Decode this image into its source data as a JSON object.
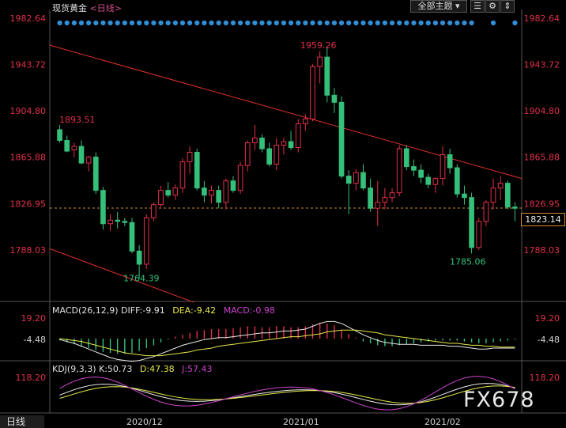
{
  "header": {
    "symbol": "现货黄金",
    "period": "<日线>",
    "theme_button": "全部主题",
    "tool_icons": [
      "list-icon",
      "settings-icon",
      "scroll-icon"
    ]
  },
  "colors": {
    "up": "#e0304a",
    "down": "#35c07a",
    "axis_text": "#e0304a",
    "trend": "#e0302a",
    "dots": "#2f8fd8",
    "cursor_line": "#d08a2a",
    "diff": "#e8e8e8",
    "dea": "#e8e84a",
    "macd": "#cc44cc"
  },
  "chart_data": [
    {
      "type": "candlestick",
      "title": "现货黄金 <日线>",
      "price_axis_left": [
        "1982.64",
        "1943.72",
        "1904.80",
        "1865.88",
        "1826.95",
        "1788.03"
      ],
      "price_axis_right": [
        "1982.64",
        "1943.72",
        "1904.80",
        "1865.88",
        "1826.95",
        "1788.03"
      ],
      "ylim": [
        1760,
        1986
      ],
      "x_labels": [
        "2020/12",
        "2021/01",
        "2021/02"
      ],
      "annotations": [
        {
          "label": "1893.51",
          "value": 1893.51
        },
        {
          "label": "1959.26",
          "value": 1959.26
        },
        {
          "label": "1764.39",
          "value": 1764.39
        },
        {
          "label": "1785.06",
          "value": 1785.06
        }
      ],
      "current_price": "1823.14",
      "candles": [
        {
          "o": 1889,
          "h": 1893,
          "l": 1878,
          "c": 1880
        },
        {
          "o": 1880,
          "h": 1884,
          "l": 1870,
          "c": 1871
        },
        {
          "o": 1872,
          "h": 1878,
          "l": 1866,
          "c": 1875
        },
        {
          "o": 1875,
          "h": 1880,
          "l": 1860,
          "c": 1861
        },
        {
          "o": 1861,
          "h": 1867,
          "l": 1854,
          "c": 1866
        },
        {
          "o": 1866,
          "h": 1870,
          "l": 1835,
          "c": 1838
        },
        {
          "o": 1838,
          "h": 1841,
          "l": 1805,
          "c": 1810
        },
        {
          "o": 1810,
          "h": 1818,
          "l": 1804,
          "c": 1813
        },
        {
          "o": 1813,
          "h": 1820,
          "l": 1806,
          "c": 1812
        },
        {
          "o": 1812,
          "h": 1815,
          "l": 1808,
          "c": 1811
        },
        {
          "o": 1811,
          "h": 1815,
          "l": 1785,
          "c": 1787
        },
        {
          "o": 1787,
          "h": 1792,
          "l": 1764,
          "c": 1776
        },
        {
          "o": 1776,
          "h": 1818,
          "l": 1772,
          "c": 1815
        },
        {
          "o": 1815,
          "h": 1828,
          "l": 1812,
          "c": 1826
        },
        {
          "o": 1826,
          "h": 1842,
          "l": 1824,
          "c": 1838
        },
        {
          "o": 1838,
          "h": 1845,
          "l": 1832,
          "c": 1834
        },
        {
          "o": 1834,
          "h": 1843,
          "l": 1830,
          "c": 1840
        },
        {
          "o": 1840,
          "h": 1865,
          "l": 1836,
          "c": 1862
        },
        {
          "o": 1862,
          "h": 1875,
          "l": 1852,
          "c": 1870
        },
        {
          "o": 1870,
          "h": 1873,
          "l": 1838,
          "c": 1840
        },
        {
          "o": 1840,
          "h": 1846,
          "l": 1828,
          "c": 1834
        },
        {
          "o": 1834,
          "h": 1842,
          "l": 1827,
          "c": 1838
        },
        {
          "o": 1838,
          "h": 1842,
          "l": 1823,
          "c": 1828
        },
        {
          "o": 1828,
          "h": 1848,
          "l": 1822,
          "c": 1846
        },
        {
          "o": 1846,
          "h": 1850,
          "l": 1836,
          "c": 1838
        },
        {
          "o": 1838,
          "h": 1862,
          "l": 1835,
          "c": 1859
        },
        {
          "o": 1859,
          "h": 1880,
          "l": 1854,
          "c": 1878
        },
        {
          "o": 1878,
          "h": 1893,
          "l": 1872,
          "c": 1882
        },
        {
          "o": 1882,
          "h": 1885,
          "l": 1870,
          "c": 1873
        },
        {
          "o": 1873,
          "h": 1878,
          "l": 1858,
          "c": 1860
        },
        {
          "o": 1860,
          "h": 1882,
          "l": 1855,
          "c": 1876
        },
        {
          "o": 1876,
          "h": 1882,
          "l": 1868,
          "c": 1879
        },
        {
          "o": 1879,
          "h": 1888,
          "l": 1872,
          "c": 1874
        },
        {
          "o": 1874,
          "h": 1898,
          "l": 1870,
          "c": 1894
        },
        {
          "o": 1894,
          "h": 1902,
          "l": 1888,
          "c": 1898
        },
        {
          "o": 1898,
          "h": 1944,
          "l": 1896,
          "c": 1942
        },
        {
          "o": 1942,
          "h": 1955,
          "l": 1928,
          "c": 1950
        },
        {
          "o": 1950,
          "h": 1959,
          "l": 1912,
          "c": 1918
        },
        {
          "o": 1918,
          "h": 1924,
          "l": 1903,
          "c": 1912
        },
        {
          "o": 1912,
          "h": 1917,
          "l": 1848,
          "c": 1850
        },
        {
          "o": 1850,
          "h": 1855,
          "l": 1818,
          "c": 1844
        },
        {
          "o": 1844,
          "h": 1856,
          "l": 1838,
          "c": 1853
        },
        {
          "o": 1853,
          "h": 1860,
          "l": 1838,
          "c": 1840
        },
        {
          "o": 1840,
          "h": 1848,
          "l": 1820,
          "c": 1823
        },
        {
          "o": 1823,
          "h": 1846,
          "l": 1808,
          "c": 1828
        },
        {
          "o": 1828,
          "h": 1840,
          "l": 1822,
          "c": 1832
        },
        {
          "o": 1832,
          "h": 1840,
          "l": 1828,
          "c": 1836
        },
        {
          "o": 1836,
          "h": 1876,
          "l": 1833,
          "c": 1873
        },
        {
          "o": 1873,
          "h": 1876,
          "l": 1855,
          "c": 1858
        },
        {
          "o": 1858,
          "h": 1864,
          "l": 1850,
          "c": 1855
        },
        {
          "o": 1855,
          "h": 1860,
          "l": 1844,
          "c": 1849
        },
        {
          "o": 1849,
          "h": 1852,
          "l": 1840,
          "c": 1843
        },
        {
          "o": 1843,
          "h": 1849,
          "l": 1836,
          "c": 1848
        },
        {
          "o": 1848,
          "h": 1875,
          "l": 1842,
          "c": 1868
        },
        {
          "o": 1868,
          "h": 1873,
          "l": 1852,
          "c": 1857
        },
        {
          "o": 1857,
          "h": 1860,
          "l": 1832,
          "c": 1835
        },
        {
          "o": 1835,
          "h": 1842,
          "l": 1826,
          "c": 1832
        },
        {
          "o": 1832,
          "h": 1836,
          "l": 1785,
          "c": 1790
        },
        {
          "o": 1790,
          "h": 1815,
          "l": 1788,
          "c": 1812
        },
        {
          "o": 1812,
          "h": 1830,
          "l": 1808,
          "c": 1828
        },
        {
          "o": 1828,
          "h": 1848,
          "l": 1822,
          "c": 1840
        },
        {
          "o": 1840,
          "h": 1850,
          "l": 1830,
          "c": 1844
        },
        {
          "o": 1844,
          "h": 1846,
          "l": 1822,
          "c": 1824
        },
        {
          "o": 1824,
          "h": 1828,
          "l": 1812,
          "c": 1823
        }
      ]
    },
    {
      "type": "macd",
      "label": "MACD(26,12,9)",
      "diff_label": "DIFF:",
      "diff": "-9.91",
      "dea_label": "DEA:",
      "dea": "-9.42",
      "macd_label": "MACD:",
      "macd": "-0.98",
      "axis": [
        "19.20",
        "-4.48"
      ],
      "histogram": [
        -2,
        -4,
        -6,
        -8,
        -10,
        -12,
        -14,
        -15,
        -16,
        -16,
        -15,
        -13,
        -10,
        -7,
        -4,
        -1,
        2,
        4,
        6,
        8,
        9,
        10,
        10,
        10,
        11,
        12,
        13,
        13,
        12,
        12,
        13,
        13,
        12,
        12,
        13,
        15,
        17,
        16,
        14,
        9,
        5,
        1,
        -3,
        -5,
        -7,
        -8,
        -8,
        -7,
        -6,
        -5,
        -4,
        -3,
        -2,
        -2,
        -2,
        -2,
        -3,
        -4,
        -5,
        -5,
        -4,
        -3,
        -2,
        -1
      ],
      "diff_line": [
        -1,
        -3,
        -5,
        -8,
        -11,
        -14,
        -17,
        -20,
        -22,
        -23,
        -24,
        -23,
        -21,
        -19,
        -16,
        -13,
        -10,
        -7,
        -5,
        -3,
        -1,
        0,
        1,
        1,
        2,
        3,
        4,
        5,
        6,
        6,
        7,
        8,
        8,
        9,
        10,
        13,
        16,
        18,
        18,
        16,
        12,
        8,
        4,
        1,
        -2,
        -4,
        -5,
        -6,
        -6,
        -6,
        -7,
        -7,
        -7,
        -7,
        -8,
        -8,
        -9,
        -10,
        -11,
        -11,
        -10,
        -10,
        -10,
        -10
      ],
      "dea_line": [
        0,
        -1,
        -2,
        -3,
        -5,
        -7,
        -9,
        -11,
        -13,
        -15,
        -16,
        -17,
        -18,
        -18,
        -18,
        -17,
        -16,
        -15,
        -14,
        -12,
        -11,
        -10,
        -8,
        -7,
        -6,
        -5,
        -4,
        -3,
        -2,
        -1,
        0,
        1,
        2,
        2,
        3,
        4,
        5,
        7,
        8,
        9,
        9,
        9,
        8,
        7,
        6,
        4,
        3,
        2,
        1,
        0,
        -1,
        -2,
        -3,
        -4,
        -5,
        -5,
        -6,
        -7,
        -7,
        -8,
        -8,
        -9,
        -9,
        -9
      ]
    },
    {
      "type": "kdj",
      "label": "KDJ(9,3,3)",
      "k_label": "K:",
      "k": "50.73",
      "d_label": "D:",
      "d": "47.38",
      "j_label": "J:",
      "j": "57.43",
      "axis": [
        "118.20"
      ]
    }
  ],
  "bottom_tab": "日线",
  "watermark": "FX678"
}
